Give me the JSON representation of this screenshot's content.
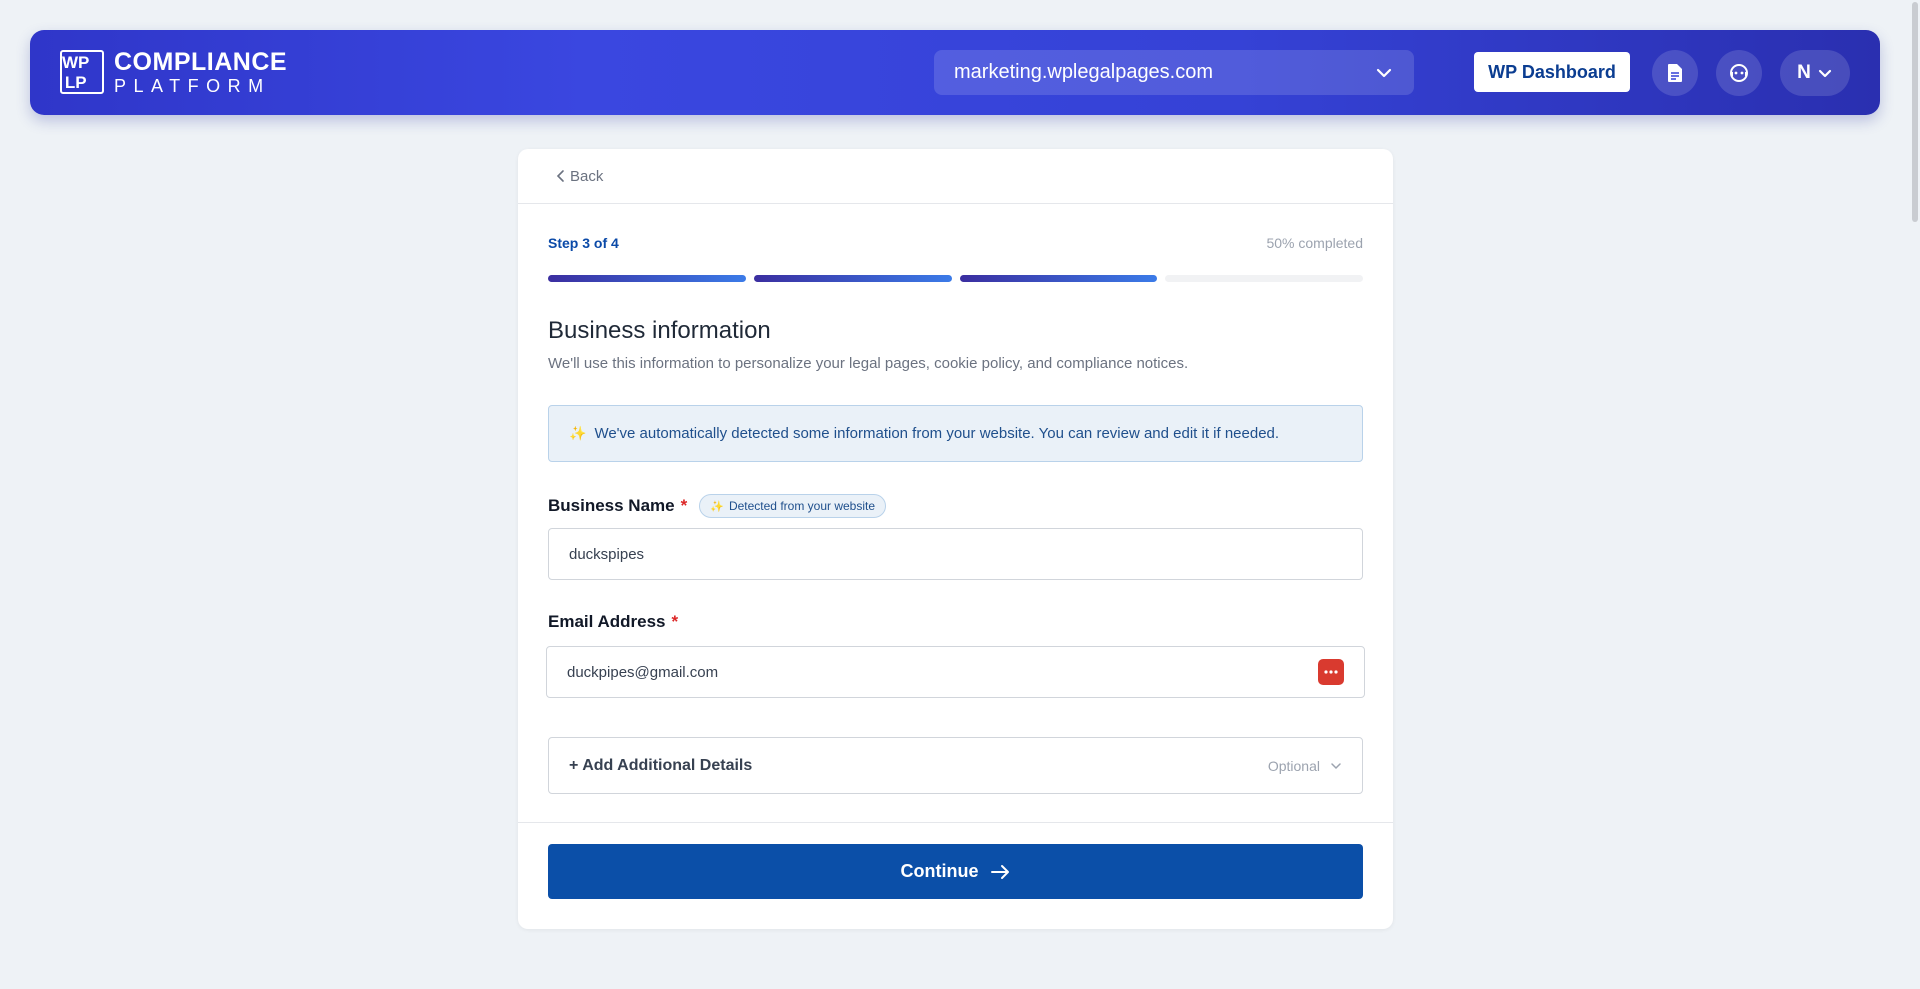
{
  "header": {
    "logo_mark": [
      "WP",
      "LP"
    ],
    "logo_title": "COMPLIANCE",
    "logo_subtitle": "PLATFORM",
    "site_selector_value": "marketing.wplegalpages.com",
    "wp_dashboard_label": "WP Dashboard",
    "user_initial": "N"
  },
  "card": {
    "back_label": "Back",
    "step_label": "Step 3 of 4",
    "completion_label": "50% completed",
    "progress": {
      "completed_segments": 3,
      "total_segments": 4
    },
    "title": "Business information",
    "subtitle": "We'll use this information to personalize your legal pages, cookie policy, and compliance notices.",
    "notice": "We've automatically detected some information from your website. You can review and edit it if needed.",
    "business_name": {
      "label": "Business Name",
      "required_mark": "*",
      "badge": "Detected from your website",
      "value": "duckspipes"
    },
    "email": {
      "label": "Email Address",
      "required_mark": "*",
      "value": "duckpipes@gmail.com"
    },
    "additional": {
      "label": "+ Add Additional Details",
      "optional_label": "Optional"
    },
    "continue_label": "Continue"
  },
  "colors": {
    "primary": "#0b4fa8",
    "header_gradient_start": "#2f36c9",
    "required": "#dc2626",
    "notice_bg": "#eaf1f8"
  }
}
